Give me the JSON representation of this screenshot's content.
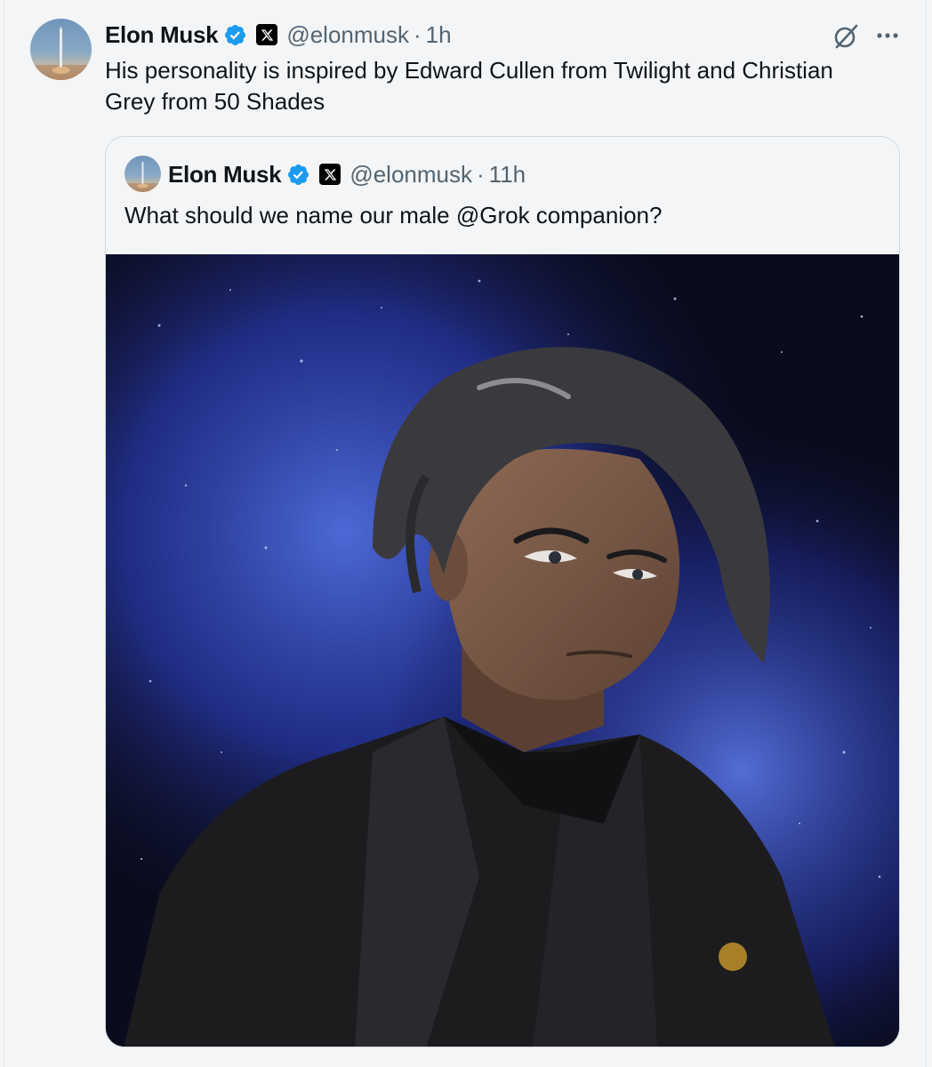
{
  "tweet": {
    "author_name": "Elon Musk",
    "handle": "@elonmusk",
    "separator": "·",
    "time": "1h",
    "text": "His personality is inspired by Edward Cullen from Twilight and Christian Grey from 50 Shades"
  },
  "quoted_tweet": {
    "author_name": "Elon Musk",
    "handle": "@elonmusk",
    "separator": "·",
    "time": "11h",
    "text": "What should we name our male @Grok companion?"
  },
  "icons": {
    "verified": "verified-badge-icon",
    "affiliate": "x-logo-icon",
    "grok": "grok-icon",
    "more": "more-icon"
  },
  "colors": {
    "verified_blue": "#1d9bf0",
    "secondary_text": "#536471",
    "background": "#f4f5f6",
    "quote_border": "#cfd9de"
  }
}
